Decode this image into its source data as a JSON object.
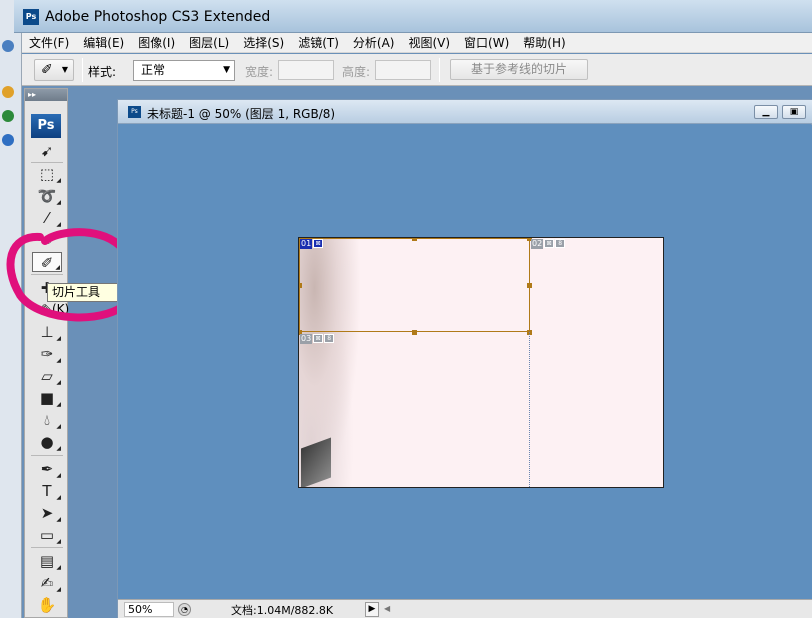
{
  "app": {
    "title": "Adobe Photoshop CS3 Extended",
    "logo": "Ps"
  },
  "menu": {
    "items": [
      "文件(F)",
      "编辑(E)",
      "图像(I)",
      "图层(L)",
      "选择(S)",
      "滤镜(T)",
      "分析(A)",
      "视图(V)",
      "窗口(W)",
      "帮助(H)"
    ]
  },
  "options": {
    "tool_icon": "slice-tool-icon",
    "style_label": "样式:",
    "style_value": "正常",
    "width_label": "宽度:",
    "height_label": "高度:",
    "guides_button": "基于参考线的切片"
  },
  "tools": {
    "badge": "Ps",
    "tooltip": "切片工具 (K)",
    "text_tool_glyph": "T"
  },
  "document": {
    "title": "未标题-1 @ 50% (图层 1, RGB/8)",
    "slices": [
      {
        "number": "01",
        "kind": "user-selected"
      },
      {
        "number": "02",
        "kind": "auto"
      },
      {
        "number": "03",
        "kind": "auto"
      }
    ],
    "zoom": "50%",
    "doc_info": "文档:1.04M/882.8K"
  },
  "colors": {
    "workspace": "#5f8fbe",
    "canvas": "#fdf1f3",
    "selection": "#b07a18",
    "annotation": "#e0107c",
    "tooltip_bg": "#ffffe1"
  }
}
